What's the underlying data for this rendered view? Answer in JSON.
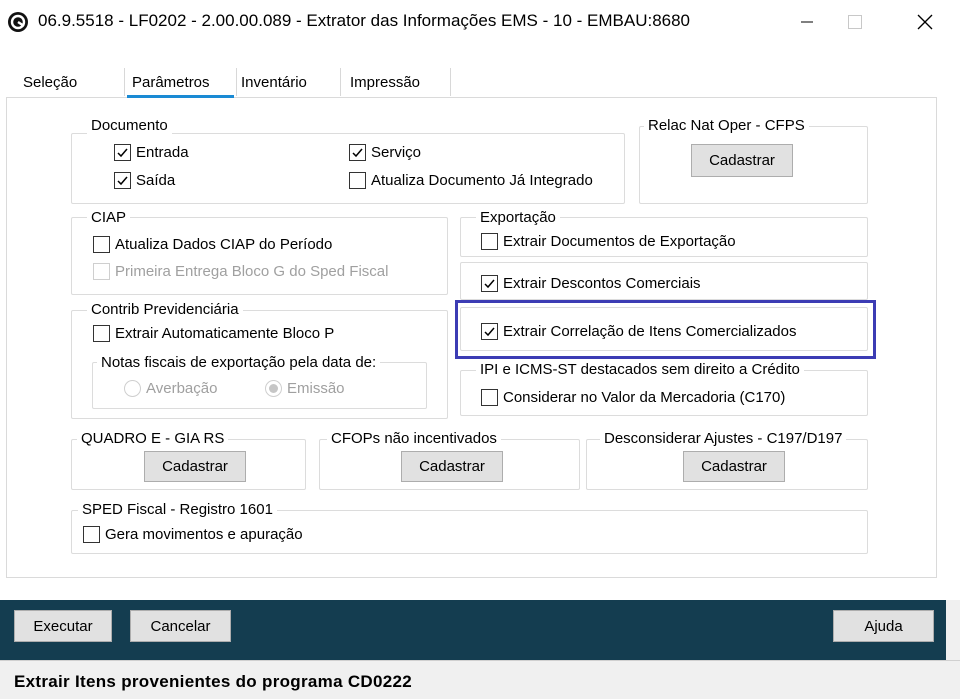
{
  "window": {
    "title": "06.9.5518 - LF0202 - 2.00.00.089 - Extrator das Informações EMS - 10 - EMBAU:8680"
  },
  "tabs": [
    {
      "label": "Seleção"
    },
    {
      "label": "Parâmetros",
      "active": true
    },
    {
      "label": "Inventário"
    },
    {
      "label": "Impressão"
    }
  ],
  "documento": {
    "label": "Documento",
    "entrada": {
      "label": "Entrada",
      "checked": true
    },
    "saida": {
      "label": "Saída",
      "checked": true
    },
    "servico": {
      "label": "Serviço",
      "checked": true
    },
    "atualiza": {
      "label": "Atualiza Documento Já Integrado",
      "checked": false
    }
  },
  "relac": {
    "label": "Relac Nat Oper - CFPS",
    "button": "Cadastrar"
  },
  "ciap": {
    "label": "CIAP",
    "atualiza": {
      "label": "Atualiza Dados CIAP do Período",
      "checked": false
    },
    "primeira": {
      "label": "Primeira Entrega Bloco G do Sped Fiscal",
      "checked": false,
      "disabled": true
    }
  },
  "exportacao": {
    "label": "Exportação",
    "extrair_docs": {
      "label": "Extrair Documentos de Exportação",
      "checked": false
    }
  },
  "descontos": {
    "label": "Extrair Descontos Comerciais",
    "checked": true
  },
  "correlacao": {
    "label": "Extrair Correlação de Itens Comercializados",
    "checked": true
  },
  "contrib": {
    "label": "Contrib Previdenciária",
    "extrair": {
      "label": "Extrair Automaticamente Bloco P",
      "checked": false
    },
    "notas": {
      "label": "Notas fiscais de exportação pela data de:",
      "averbacao": {
        "label": "Averbação",
        "selected": false
      },
      "emissao": {
        "label": "Emissão",
        "selected": true
      }
    }
  },
  "ipi": {
    "label": "IPI e ICMS-ST destacados sem direito a Crédito",
    "considerar": {
      "label": "Considerar no Valor da Mercadoria (C170)",
      "checked": false
    }
  },
  "quadro": {
    "label": "QUADRO E - GIA RS",
    "button": "Cadastrar"
  },
  "cfops": {
    "label": "CFOPs não incentivados",
    "button": "Cadastrar"
  },
  "desconsiderar": {
    "label": "Desconsiderar Ajustes - C197/D197",
    "button": "Cadastrar"
  },
  "sped": {
    "label": "SPED Fiscal - Registro 1601",
    "gera": {
      "label": "Gera movimentos e apuração",
      "checked": false
    }
  },
  "actions": {
    "executar": "Executar",
    "cancelar": "Cancelar",
    "ajuda": "Ajuda"
  },
  "status": {
    "text": "Extrair Itens provenientes do programa CD0222"
  },
  "colors": {
    "accent": "#1a8ad4",
    "highlight": "#3c3cb4",
    "bottom_bar": "#143d50"
  }
}
